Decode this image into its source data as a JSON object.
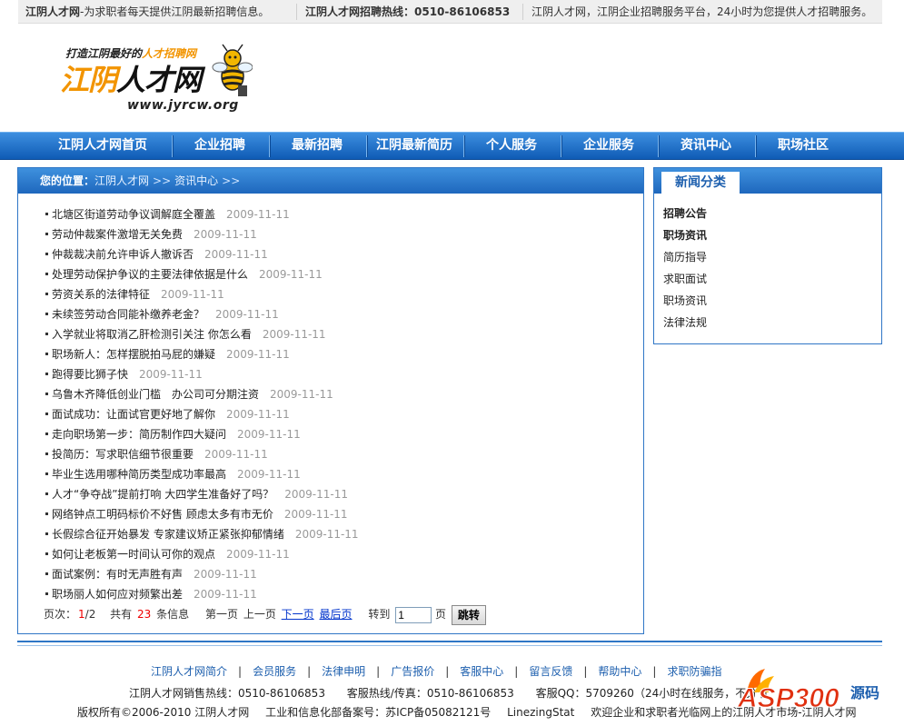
{
  "topbar": {
    "site": "江阴人才网",
    "tagline": "-为求职者每天提供江阴最新招聘信息。",
    "hotline": "江阴人才网招聘热线：0510-86106853",
    "service": "江阴人才网，江阴企业招聘服务平台，24小时为您提供人才招聘服务。"
  },
  "logo": {
    "slogan_prefix": "打造江阴最好的",
    "slogan_highlight": "人才招聘网",
    "brand_part1": "江阴",
    "brand_part2": "人才网",
    "url": "www.jyrcw.org"
  },
  "nav": [
    "江阴人才网首页",
    "企业招聘",
    "最新招聘",
    "江阴最新简历",
    "个人服务",
    "企业服务",
    "资讯中心",
    "职场社区"
  ],
  "breadcrumb": {
    "label": "您的位置：",
    "home": "江阴人才网",
    "sep": ">>",
    "current": "资讯中心",
    "tail": ">>"
  },
  "news": [
    {
      "title": "北塘区街道劳动争议调解庭全覆盖",
      "date": "2009-11-11"
    },
    {
      "title": "劳动仲裁案件激增无关免费",
      "date": "2009-11-11"
    },
    {
      "title": "仲裁裁决前允许申诉人撤诉否",
      "date": "2009-11-11"
    },
    {
      "title": "处理劳动保护争议的主要法律依据是什么",
      "date": "2009-11-11"
    },
    {
      "title": "劳资关系的法律特征",
      "date": "2009-11-11"
    },
    {
      "title": "未续签劳动合同能补缴养老金？",
      "date": "2009-11-11"
    },
    {
      "title": "入学就业将取消乙肝检测引关注 你怎么看",
      "date": "2009-11-11"
    },
    {
      "title": "职场新人：怎样摆脱拍马屁的嫌疑",
      "date": "2009-11-11"
    },
    {
      "title": "跑得要比狮子快",
      "date": "2009-11-11"
    },
    {
      "title": "乌鲁木齐降低创业门槛　办公司可分期注资",
      "date": "2009-11-11"
    },
    {
      "title": "面试成功：让面试官更好地了解你",
      "date": "2009-11-11"
    },
    {
      "title": "走向职场第一步：简历制作四大疑问",
      "date": "2009-11-11"
    },
    {
      "title": "投简历：写求职信细节很重要",
      "date": "2009-11-11"
    },
    {
      "title": "毕业生选用哪种简历类型成功率最高",
      "date": "2009-11-11"
    },
    {
      "title": "人才“争夺战”提前打响 大四学生准备好了吗？",
      "date": "2009-11-11"
    },
    {
      "title": "网络钟点工明码标价不好售 顾虑太多有市无价",
      "date": "2009-11-11"
    },
    {
      "title": "长假综合征开始暴发 专家建议矫正紧张抑郁情绪",
      "date": "2009-11-11"
    },
    {
      "title": "如何让老板第一时间认可你的观点",
      "date": "2009-11-11"
    },
    {
      "title": "面试案例：有时无声胜有声",
      "date": "2009-11-11"
    },
    {
      "title": "职场丽人如何应对频繁出差",
      "date": "2009-11-11"
    }
  ],
  "pager": {
    "page_label": "页次：",
    "page_current": "1",
    "page_total": "/2",
    "total_prefix": "共有",
    "total_count": "23",
    "total_suffix": "条信息",
    "first": "第一页",
    "prev": "上一页",
    "next": "下一页",
    "last": "最后页",
    "goto_label": "转到",
    "goto_value": "1",
    "page_unit": "页",
    "jump_button": "跳转"
  },
  "sidebar": {
    "tab": "新闻分类",
    "categories": [
      {
        "label": "招聘公告",
        "bold": true
      },
      {
        "label": "职场资讯",
        "bold": true
      },
      {
        "label": "简历指导",
        "bold": false
      },
      {
        "label": "求职面试",
        "bold": false
      },
      {
        "label": "职场资讯",
        "bold": false
      },
      {
        "label": "法律法规",
        "bold": false
      }
    ]
  },
  "footer": {
    "links": [
      "江阴人才网简介",
      "会员服务",
      "法律申明",
      "广告报价",
      "客服中心",
      "留言反馈",
      "帮助中心",
      "求职防骗指"
    ],
    "contact": [
      "江阴人才网销售热线：0510-86106853",
      "客服热线/传真：0510-86106853",
      "客服QQ：5709260（24小时在线服务，不分节"
    ],
    "copyright": [
      "版权所有©2006-2010 江阴人才网",
      "工业和信息化部备案号：苏ICP备05082121号",
      "LinezingStat",
      "欢迎企业和求职者光临网上的江阴人才市场-江阴人才网"
    ]
  },
  "watermark": {
    "text": "ASP300",
    "sub": "源码"
  }
}
